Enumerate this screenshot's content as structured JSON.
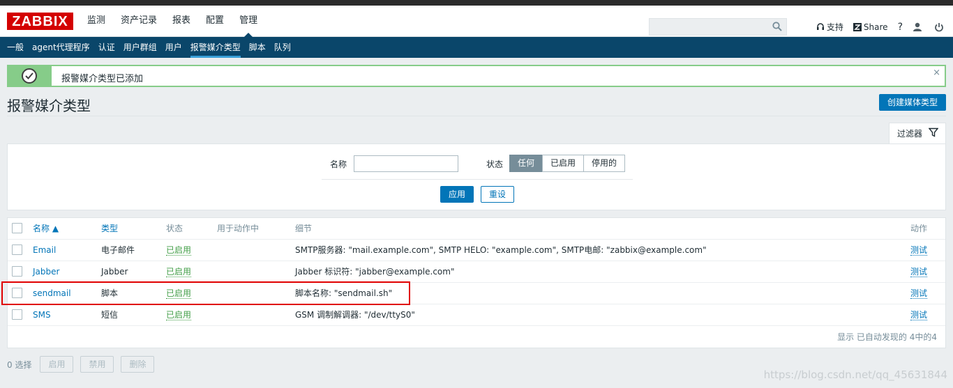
{
  "header": {
    "logo": "ZABBIX",
    "menu": [
      "监测",
      "资产记录",
      "报表",
      "配置",
      "管理"
    ],
    "support": "支持",
    "share": "Share",
    "help": "?",
    "search_placeholder": ""
  },
  "submenu": [
    "一般",
    "agent代理程序",
    "认证",
    "用户群组",
    "用户",
    "报警媒介类型",
    "脚本",
    "队列"
  ],
  "message": {
    "text": "报警媒介类型已添加",
    "close": "×"
  },
  "page": {
    "title": "报警媒介类型",
    "create_button": "创建媒体类型"
  },
  "filter": {
    "tab_label": "过滤器",
    "name_label": "名称",
    "name_value": "",
    "status_label": "状态",
    "status_options": [
      "任何",
      "已启用",
      "停用的"
    ],
    "status_selected": "任何",
    "apply": "应用",
    "reset": "重设"
  },
  "table": {
    "columns": [
      "名称 ▲",
      "类型",
      "状态",
      "用于动作中",
      "细节",
      "动作"
    ],
    "rows": [
      {
        "name": "Email",
        "type": "电子邮件",
        "status": "已启用",
        "used_in": "",
        "details": "SMTP服务器: \"mail.example.com\", SMTP HELO: \"example.com\", SMTP电邮: \"zabbix@example.com\"",
        "action": "测试"
      },
      {
        "name": "Jabber",
        "type": "Jabber",
        "status": "已启用",
        "used_in": "",
        "details": "Jabber 标识符: \"jabber@example.com\"",
        "action": "测试"
      },
      {
        "name": "sendmail",
        "type": "脚本",
        "status": "已启用",
        "used_in": "",
        "details": "脚本名称: \"sendmail.sh\"",
        "action": "测试"
      },
      {
        "name": "SMS",
        "type": "短信",
        "status": "已启用",
        "used_in": "",
        "details": "GSM 调制解调器: \"/dev/ttyS0\"",
        "action": "测试"
      }
    ],
    "footer": "显示 已自动发现的 4中的4"
  },
  "bottom": {
    "selected": "0 选择",
    "buttons": [
      "启用",
      "禁用",
      "删除"
    ]
  },
  "watermark": "https://blog.csdn.net/qq_45631844"
}
